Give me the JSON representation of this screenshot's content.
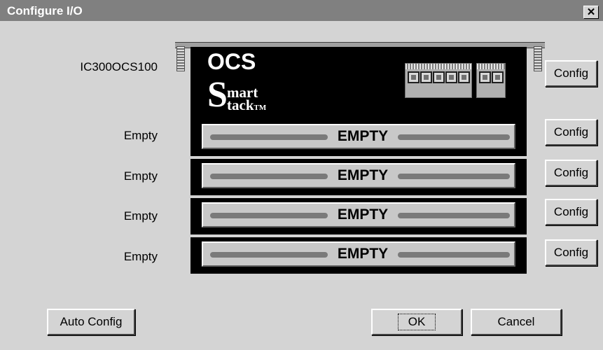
{
  "window": {
    "title": "Configure I/O",
    "close_glyph": "✕"
  },
  "cpu": {
    "label": "IC300OCS100",
    "brand": "OCS",
    "logo_s": "S",
    "logo_line1": "mart",
    "logo_line2": "tack",
    "logo_tm": "TM",
    "config_label": "Config"
  },
  "slots": [
    {
      "label": "Empty",
      "module_text": "EMPTY",
      "config_label": "Config"
    },
    {
      "label": "Empty",
      "module_text": "EMPTY",
      "config_label": "Config"
    },
    {
      "label": "Empty",
      "module_text": "EMPTY",
      "config_label": "Config"
    },
    {
      "label": "Empty",
      "module_text": "EMPTY",
      "config_label": "Config"
    }
  ],
  "buttons": {
    "auto_config": "Auto Config",
    "ok": "OK",
    "cancel": "Cancel"
  },
  "colors": {
    "titlebar": "#808080",
    "background": "#d4d4d4",
    "rack": "#000000"
  }
}
